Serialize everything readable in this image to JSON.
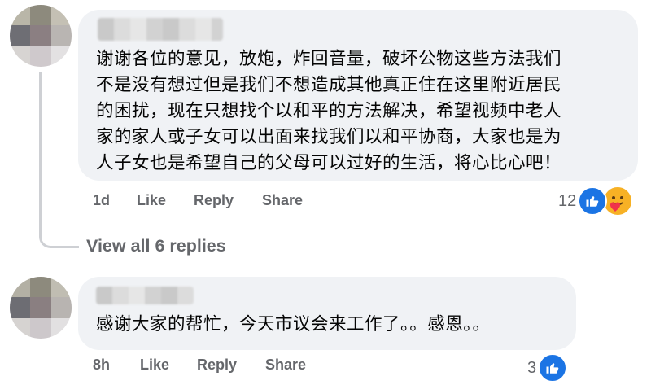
{
  "comments": [
    {
      "text": "谢谢各位的意见，放炮，炸回音量，破坏公物这些方法我们\n不是没有想过但是我们不想造成其他真正住在这里附近居民\n的困扰，现在只想找个以和平的方法解决，希望视频中老人\n家的家人或子女可以出面来找我们以和平协商，大家也是为\n人子女也是希望自己的父母可以过好的生活，将心比心吧！",
      "time": "1d",
      "like_label": "Like",
      "reply_label": "Reply",
      "share_label": "Share",
      "reaction_count": "12",
      "reaction_icons": [
        "like-icon",
        "care-icon"
      ]
    },
    {
      "text": "感谢大家的帮忙，今天市议会来工作了。。感恩。。",
      "time": "8h",
      "like_label": "Like",
      "reply_label": "Reply",
      "share_label": "Share",
      "reaction_count": "3",
      "reaction_icons": [
        "like-icon"
      ]
    }
  ],
  "view_replies_label": "View all 6 replies",
  "colors": {
    "bubble": "#f0f2f5",
    "meta_text": "#65676b",
    "like_blue": "#1b74e4",
    "care_yellow": "#f7b125"
  }
}
